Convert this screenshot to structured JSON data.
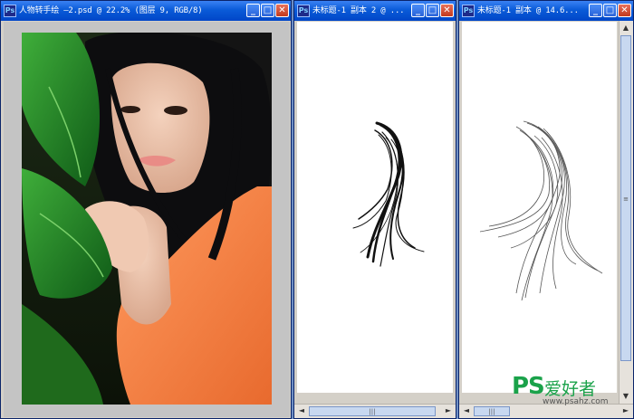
{
  "windows": [
    {
      "title": "人物转手绘 —2.psd @ 22.2% (图层 9, RGB/8)",
      "icon_label": "Ps"
    },
    {
      "title": "未标题-1 副本 2 @ ...",
      "icon_label": "Ps"
    },
    {
      "title": "未标题-1 副本 @ 14.6...",
      "icon_label": "Ps"
    }
  ],
  "title_buttons": {
    "minimize": "_",
    "maximize": "□",
    "close": "✕"
  },
  "scroll_glyphs": {
    "left": "◄",
    "right": "►",
    "up": "▲",
    "down": "▼",
    "grip": "|||",
    "vgrip": "≡"
  },
  "watermark": {
    "brand": "PS",
    "cn": "爱好者",
    "url": "www.psahz.com"
  },
  "colors": {
    "titlebar": "#0a5bd8",
    "close_button": "#c23a1e",
    "workspace": "#c4c4c4",
    "watermark": "#1aa24a"
  }
}
